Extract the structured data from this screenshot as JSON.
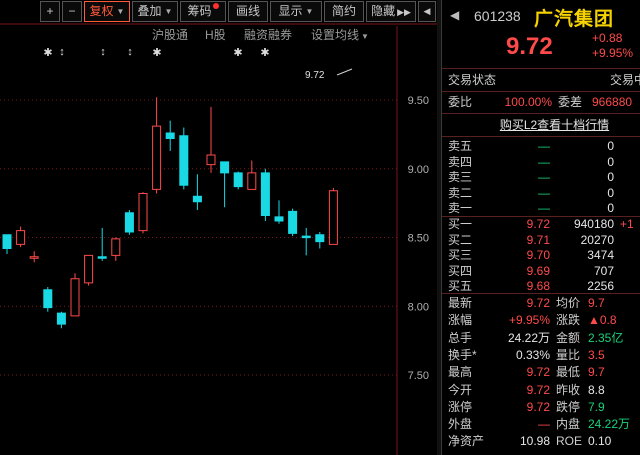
{
  "toolbar": {
    "plus": "+",
    "minus": "−",
    "fuquan": "复权",
    "diejia": "叠加",
    "chouma": "筹码",
    "huaxian": "画线",
    "xianshi": "显示",
    "jianyue": "简约",
    "yincang": "隐藏",
    "more": "▶▶",
    "right_arrow": "◀"
  },
  "subbar": {
    "hugutong": "沪股通",
    "h_stock": "H股",
    "rongzi": "融资融券",
    "setting": "设置均线"
  },
  "marks": [
    "✱",
    "↕",
    "↕",
    "↕",
    "✱",
    "✱",
    "✱"
  ],
  "chart_data": {
    "type": "candlestick",
    "y_ticks": [
      "9.50",
      "9.00",
      "8.50",
      "8.00",
      "7.50"
    ],
    "ylim": [
      7.3,
      9.75
    ],
    "latest_price_label": "9.72",
    "candles": [
      {
        "open": 8.52,
        "close": 8.42,
        "high": 8.52,
        "low": 8.38
      },
      {
        "open": 8.45,
        "close": 8.55,
        "high": 8.58,
        "low": 8.43
      },
      {
        "open": 8.36,
        "close": 8.36,
        "high": 8.4,
        "low": 8.32
      },
      {
        "open": 8.12,
        "close": 7.99,
        "high": 8.14,
        "low": 7.96
      },
      {
        "open": 7.95,
        "close": 7.87,
        "high": 7.96,
        "low": 7.84
      },
      {
        "open": 7.93,
        "close": 8.2,
        "high": 8.24,
        "low": 7.93
      },
      {
        "open": 8.17,
        "close": 8.37,
        "high": 8.37,
        "low": 8.15
      },
      {
        "open": 8.36,
        "close": 8.35,
        "high": 8.57,
        "low": 8.33
      },
      {
        "open": 8.37,
        "close": 8.49,
        "high": 8.5,
        "low": 8.33
      },
      {
        "open": 8.68,
        "close": 8.54,
        "high": 8.7,
        "low": 8.52
      },
      {
        "open": 8.55,
        "close": 8.82,
        "high": 8.83,
        "low": 8.53
      },
      {
        "open": 8.85,
        "close": 9.31,
        "high": 9.52,
        "low": 8.82
      },
      {
        "open": 9.26,
        "close": 9.22,
        "high": 9.35,
        "low": 9.13
      },
      {
        "open": 9.24,
        "close": 8.88,
        "high": 9.3,
        "low": 8.85
      },
      {
        "open": 8.8,
        "close": 8.76,
        "high": 8.96,
        "low": 8.7
      },
      {
        "open": 9.03,
        "close": 9.1,
        "high": 9.45,
        "low": 8.97
      },
      {
        "open": 9.05,
        "close": 8.97,
        "high": 9.05,
        "low": 8.72
      },
      {
        "open": 8.97,
        "close": 8.87,
        "high": 8.98,
        "low": 8.85
      },
      {
        "open": 8.85,
        "close": 8.97,
        "high": 9.06,
        "low": 8.85
      },
      {
        "open": 8.97,
        "close": 8.66,
        "high": 9.0,
        "low": 8.62
      },
      {
        "open": 8.65,
        "close": 8.62,
        "high": 8.77,
        "low": 8.6
      },
      {
        "open": 8.69,
        "close": 8.53,
        "high": 8.71,
        "low": 8.51
      },
      {
        "open": 8.51,
        "close": 8.5,
        "high": 8.57,
        "low": 8.37
      },
      {
        "open": 8.52,
        "close": 8.47,
        "high": 8.54,
        "low": 8.42
      },
      {
        "open": 8.45,
        "close": 8.84,
        "high": 8.86,
        "low": 8.45
      }
    ]
  },
  "colors": {
    "up": "#ff4a4a",
    "down": "#19d9e5",
    "accent": "#ff5a3a",
    "stock_name": "#f5d200",
    "divider": "#8a1d1d"
  },
  "quote": {
    "back_icon": "◀",
    "code": "601238",
    "name": "广汽集团",
    "price": "9.72",
    "change": "+0.88",
    "change_pct": "+9.95%",
    "status_label": "交易状态",
    "status_value": "交易中",
    "weibi_label": "委比",
    "weibi_value": "100.00%",
    "weicha_label": "委差",
    "weicha_value": "966880",
    "l2_link": "购买L2查看十档行情",
    "asks": [
      {
        "label": "卖五",
        "price": "—",
        "vol": "0"
      },
      {
        "label": "卖四",
        "price": "—",
        "vol": "0"
      },
      {
        "label": "卖三",
        "price": "—",
        "vol": "0"
      },
      {
        "label": "卖二",
        "price": "—",
        "vol": "0"
      },
      {
        "label": "卖一",
        "price": "—",
        "vol": "0"
      }
    ],
    "bids": [
      {
        "label": "买一",
        "price": "9.72",
        "vol": "940180",
        "extra": "+1"
      },
      {
        "label": "买二",
        "price": "9.71",
        "vol": "20270",
        "extra": ""
      },
      {
        "label": "买三",
        "price": "9.70",
        "vol": "3474",
        "extra": ""
      },
      {
        "label": "买四",
        "price": "9.69",
        "vol": "707",
        "extra": ""
      },
      {
        "label": "买五",
        "price": "9.68",
        "vol": "2256",
        "extra": ""
      }
    ],
    "stats": [
      {
        "l1": "最新",
        "v1": "9.72",
        "c1": "red",
        "l2": "均价",
        "v2": "9.7",
        "c2": "red"
      },
      {
        "l1": "涨幅",
        "v1": "+9.95%",
        "c1": "red",
        "l2": "涨跌",
        "v2": "▲0.8",
        "c2": "red"
      },
      {
        "l1": "总手",
        "v1": "24.22万",
        "c1": "white",
        "l2": "金额",
        "v2": "2.35亿",
        "c2": "green"
      },
      {
        "l1": "换手*",
        "v1": "0.33%",
        "c1": "white",
        "l2": "量比",
        "v2": "3.5",
        "c2": "red"
      },
      {
        "l1": "最高",
        "v1": "9.72",
        "c1": "red",
        "l2": "最低",
        "v2": "9.7",
        "c2": "red"
      },
      {
        "l1": "今开",
        "v1": "9.72",
        "c1": "red",
        "l2": "昨收",
        "v2": "8.8",
        "c2": "white"
      },
      {
        "l1": "涨停",
        "v1": "9.72",
        "c1": "red",
        "l2": "跌停",
        "v2": "7.9",
        "c2": "green"
      },
      {
        "l1": "外盘",
        "v1": "—",
        "c1": "red",
        "l2": "内盘",
        "v2": "24.22万",
        "c2": "green"
      },
      {
        "l1": "净资产",
        "v1": "10.98",
        "c1": "white",
        "l2": "ROE",
        "v2": "0.10",
        "c2": "white"
      }
    ]
  }
}
